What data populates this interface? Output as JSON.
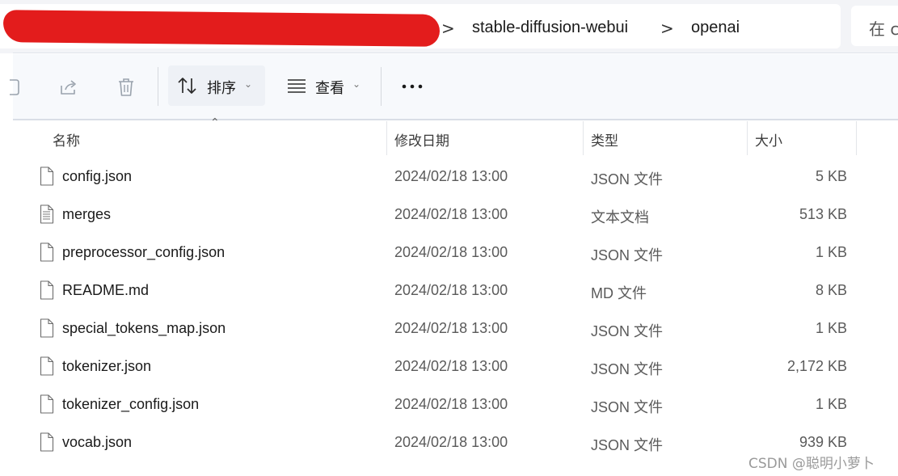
{
  "address_bar": {
    "breadcrumbs": [
      "stable-diffusion-webui",
      "openai"
    ],
    "separator": ">",
    "search_placeholder": "在 c"
  },
  "toolbar": {
    "sort_label": "排序",
    "view_label": "查看",
    "more_label": "···"
  },
  "columns": {
    "name": "名称",
    "modified": "修改日期",
    "type": "类型",
    "size": "大小"
  },
  "files": [
    {
      "name": "config.json",
      "modified": "2024/02/18 13:00",
      "type": "JSON 文件",
      "size": "5 KB",
      "icon": "document-icon"
    },
    {
      "name": "merges",
      "modified": "2024/02/18 13:00",
      "type": "文本文档",
      "size": "513 KB",
      "icon": "text-document-icon"
    },
    {
      "name": "preprocessor_config.json",
      "modified": "2024/02/18 13:00",
      "type": "JSON 文件",
      "size": "1 KB",
      "icon": "document-icon"
    },
    {
      "name": "README.md",
      "modified": "2024/02/18 13:00",
      "type": "MD 文件",
      "size": "8 KB",
      "icon": "document-icon"
    },
    {
      "name": "special_tokens_map.json",
      "modified": "2024/02/18 13:00",
      "type": "JSON 文件",
      "size": "1 KB",
      "icon": "document-icon"
    },
    {
      "name": "tokenizer.json",
      "modified": "2024/02/18 13:00",
      "type": "JSON 文件",
      "size": "2,172 KB",
      "icon": "document-icon"
    },
    {
      "name": "tokenizer_config.json",
      "modified": "2024/02/18 13:00",
      "type": "JSON 文件",
      "size": "1 KB",
      "icon": "document-icon"
    },
    {
      "name": "vocab.json",
      "modified": "2024/02/18 13:00",
      "type": "JSON 文件",
      "size": "939 KB",
      "icon": "document-icon"
    }
  ],
  "watermark": "CSDN @聪明小萝卜",
  "colors": {
    "redaction": "#e31c1c",
    "toolbar_bg": "#f7f9fc",
    "address_bg": "#f3f4f7"
  }
}
